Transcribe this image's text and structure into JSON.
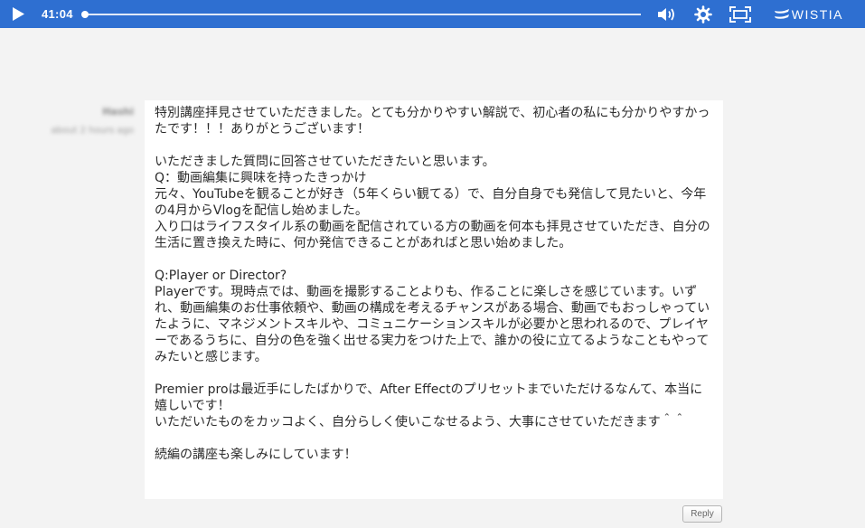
{
  "player": {
    "time": "41:04",
    "progress": 0.0,
    "brand": "WISTIA",
    "icons": {
      "play": "play-icon",
      "volume": "volume-icon",
      "settings": "gear-icon",
      "fullscreen": "fullscreen-icon",
      "logo": "wistia-logo"
    },
    "bar_color": "#2e6fd1"
  },
  "comment": {
    "author": "Hashi",
    "timestamp": "about 2 hours ago",
    "paragraphs": [
      "特別講座拝見させていただきました。とても分かりやすい解説で、初心者の私にも分かりやすかったです！！！ありがとうございます！",
      "",
      "いただきました質問に回答させていただきたいと思います。",
      "Q：動画編集に興味を持ったきっかけ",
      "元々、YouTubeを観ることが好き（5年くらい観てる）で、自分自身でも発信して見たいと、今年の4月からVlogを配信し始めました。",
      "入り口はライフスタイル系の動画を配信されている方の動画を何本も拝見させていただき、自分の生活に置き換えた時に、何か発信できることがあればと思い始めました。",
      "",
      "Q:Player or Director?",
      "Playerです。現時点では、動画を撮影することよりも、作ることに楽しさを感じています。いずれ、動画編集のお仕事依頼や、動画の構成を考えるチャンスがある場合、動画でもおっしゃっていたように、マネジメントスキルや、コミュニケーションスキルが必要かと思われるので、プレイヤーであるうちに、自分の色を強く出せる実力をつけた上で、誰かの役に立てるようなこともやってみたいと感じます。",
      "",
      "Premier proは最近手にしたばかりで、After Effectのプリセットまでいただけるなんて、本当に嬉しいです！",
      "いただいたものをカッコよく、自分らしく使いこなせるよう、大事にさせていただきます＾＾",
      "",
      "続編の講座も楽しみにしています！"
    ],
    "reply_label": "Reply"
  }
}
